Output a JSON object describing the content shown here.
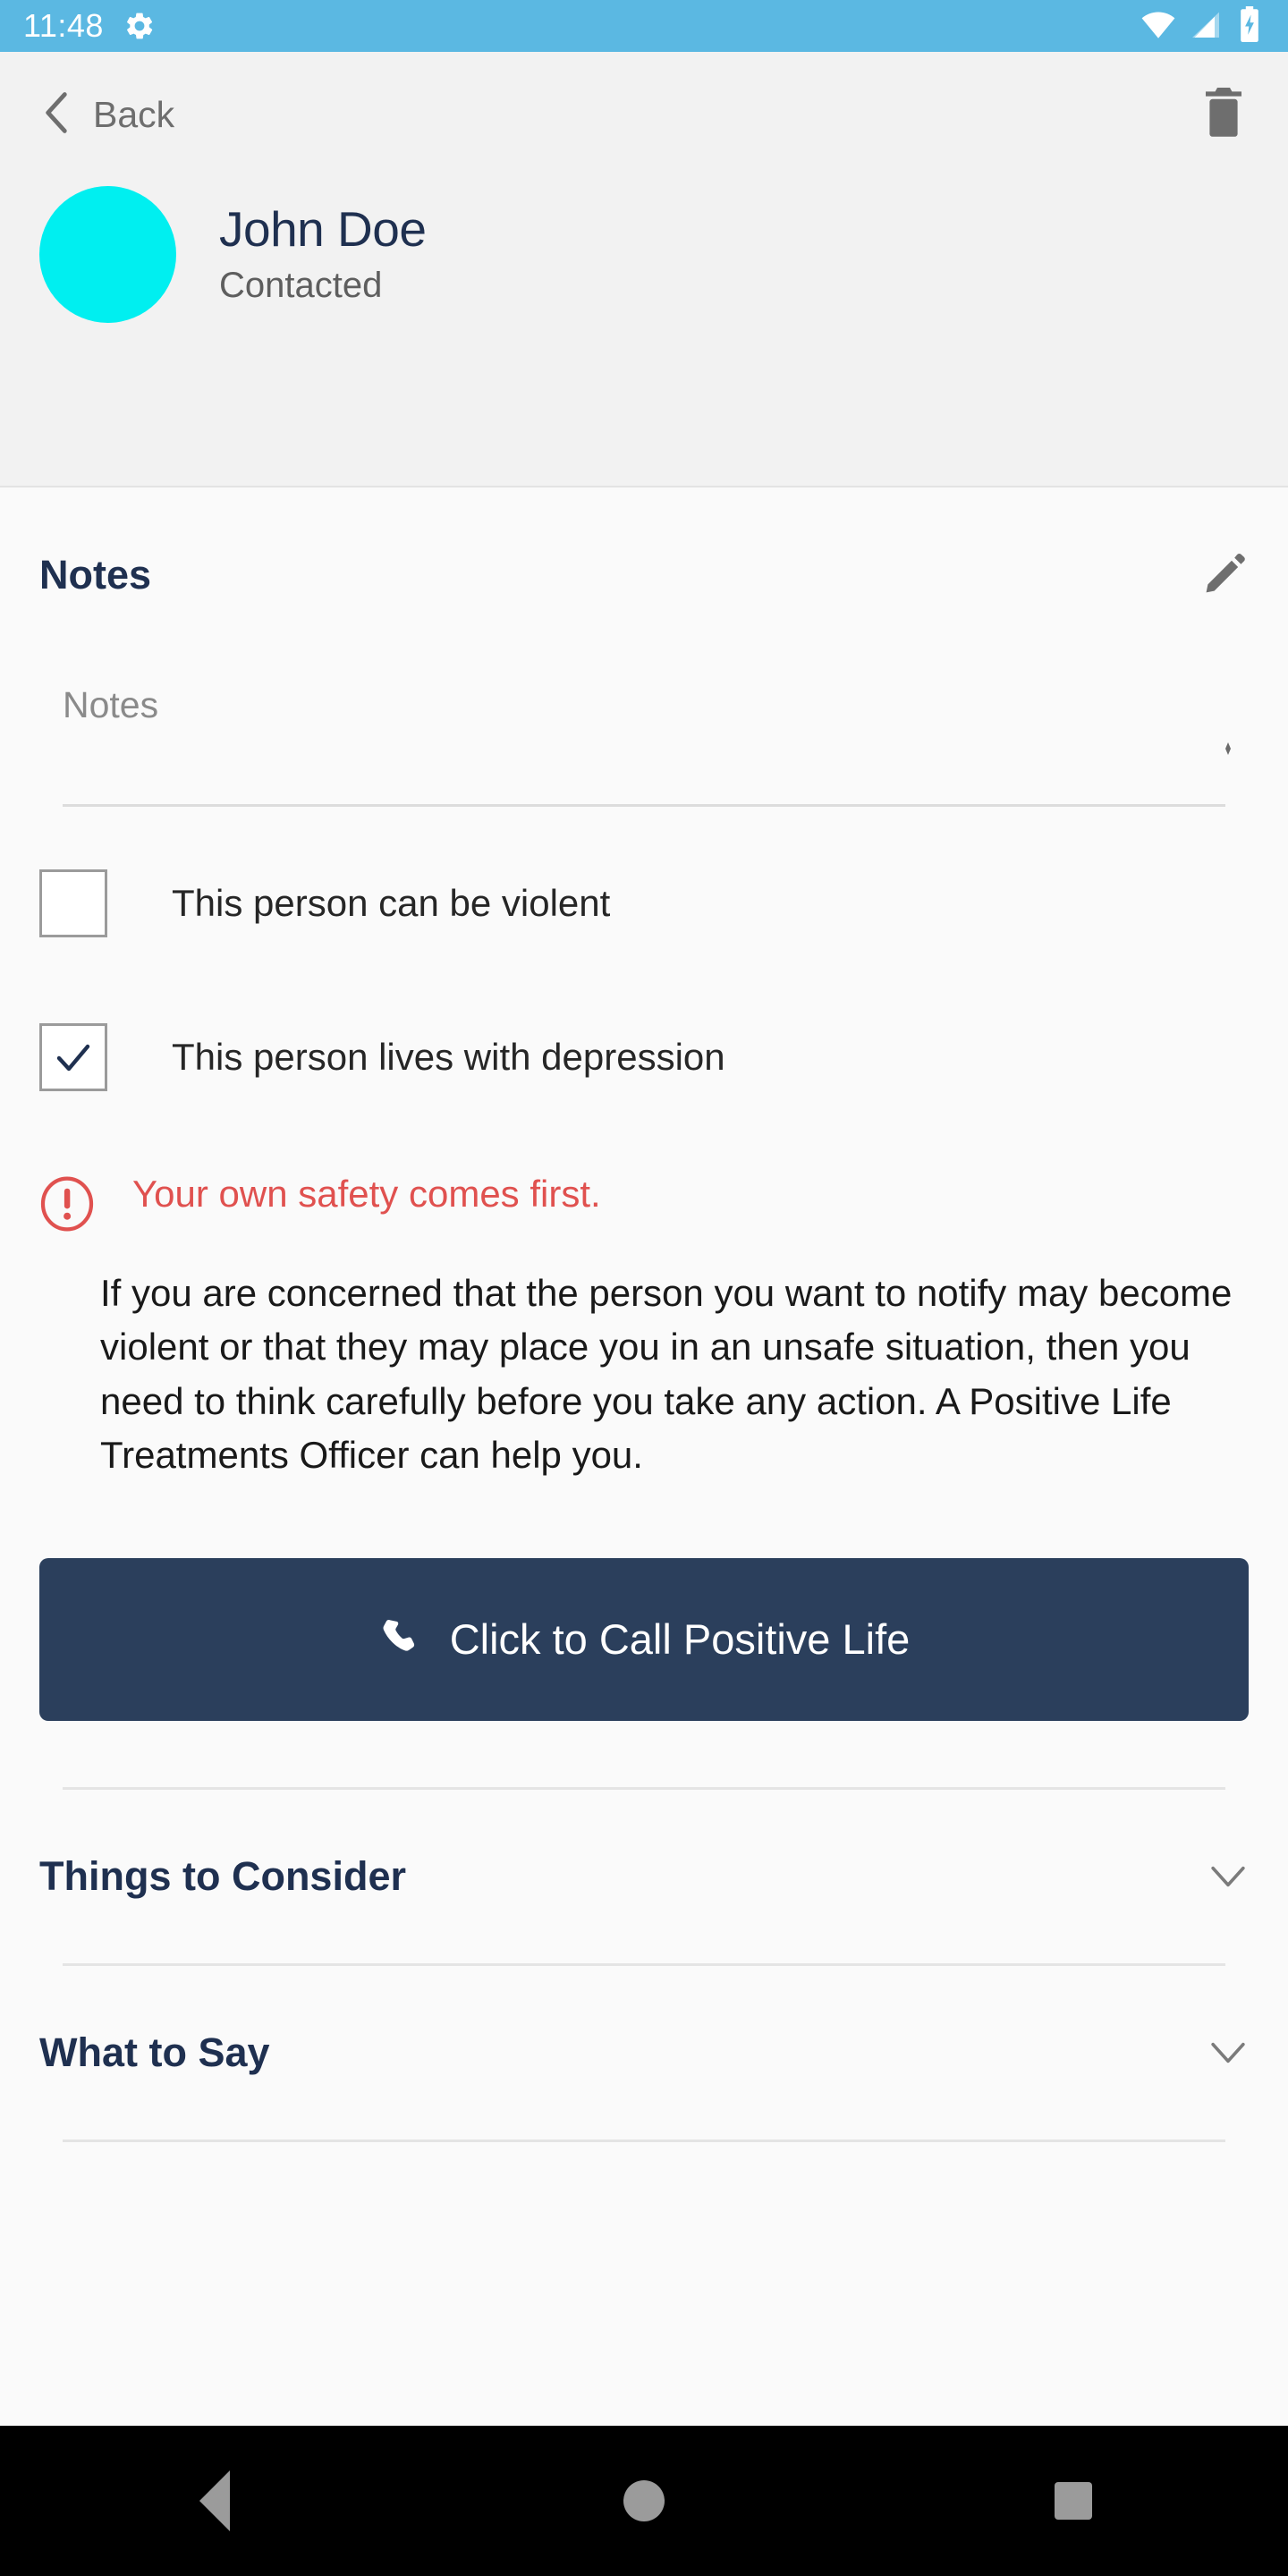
{
  "statusbar": {
    "time": "11:48",
    "gear_icon": "gear-icon",
    "wifi_icon": "wifi-icon",
    "signal_icon": "signal-icon",
    "battery_icon": "battery-charging-icon"
  },
  "navbar": {
    "back_label": "Back",
    "back_icon": "chevron-left-icon",
    "delete_icon": "trash-icon"
  },
  "person": {
    "name": "John Doe",
    "status": "Contacted",
    "avatar_color": "#00eff0"
  },
  "notes": {
    "title": "Notes",
    "edit_icon": "pencil-icon",
    "value": "",
    "placeholder": "Notes"
  },
  "checkboxes": [
    {
      "label": "This person can be violent",
      "checked": false
    },
    {
      "label": "This person lives with depression",
      "checked": true
    }
  ],
  "warning": {
    "icon": "alert-circle-icon",
    "title": "Your own safety comes first.",
    "body": "If you are concerned that the person you want to notify may become violent or that they may place you in an unsafe situation, then you need to think carefully before you take any action. A Positive Life Treatments Officer can help you.",
    "color": "#e0514f"
  },
  "call_button": {
    "label": "Click to Call Positive Life",
    "icon": "phone-icon",
    "background": "#2b3f5c"
  },
  "accordions": [
    {
      "label": "Things to Consider",
      "icon": "chevron-down-icon",
      "expanded": false
    },
    {
      "label": "What to Say",
      "icon": "chevron-down-icon",
      "expanded": false
    }
  ],
  "androidnav": {
    "back_icon": "triangle-back-icon",
    "home_icon": "circle-home-icon",
    "recents_icon": "square-recents-icon"
  },
  "colors": {
    "status_bar": "#5bb8e2",
    "header_bg": "#f2f2f2",
    "body_bg": "#fafafa",
    "navy": "#1f3050",
    "gray_icon": "#6e6e6e"
  }
}
